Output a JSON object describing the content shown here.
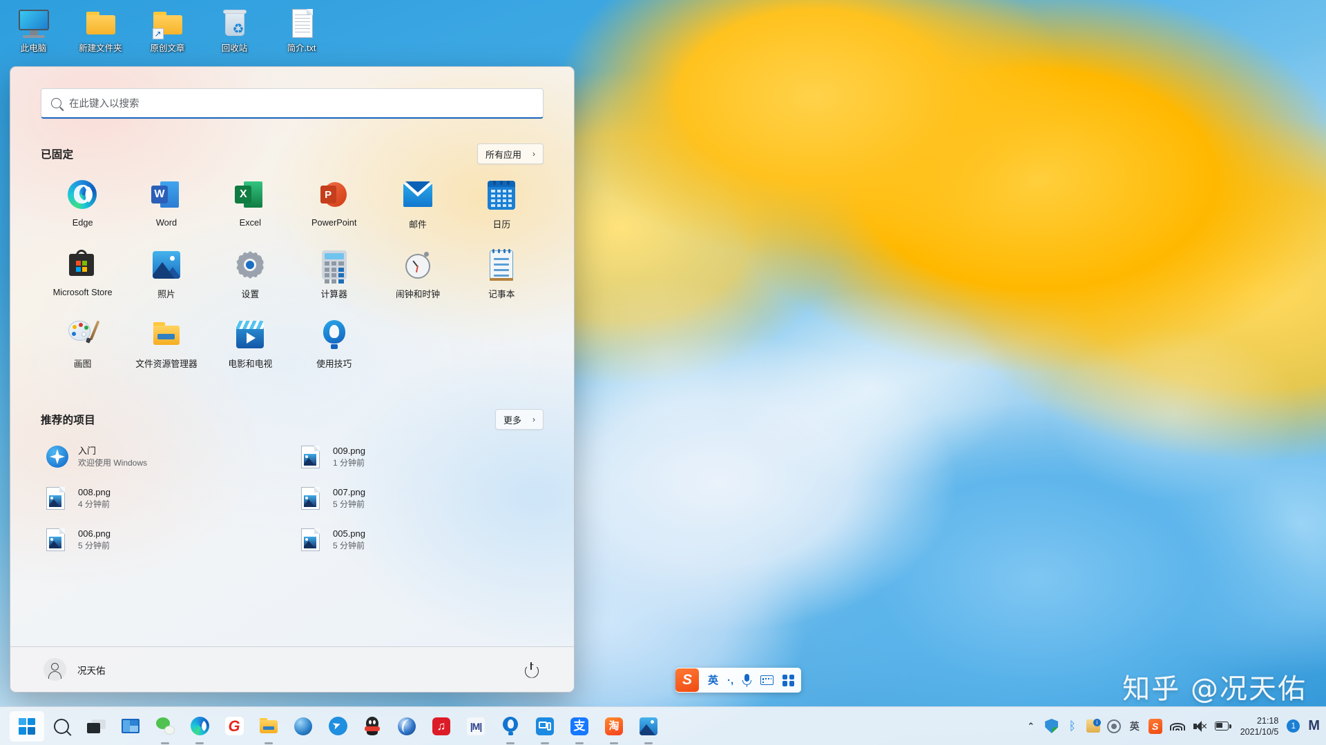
{
  "desktop": {
    "icons": [
      {
        "label": "此电脑",
        "icon": "this-pc-icon"
      },
      {
        "label": "新建文件夹",
        "icon": "folder-icon"
      },
      {
        "label": "原创文章",
        "icon": "folder-shortcut-icon"
      },
      {
        "label": "回收站",
        "icon": "recycle-bin-icon"
      },
      {
        "label": "简介.txt",
        "icon": "text-file-icon"
      }
    ],
    "watermark": "知乎 @况天佑"
  },
  "start_menu": {
    "search": {
      "placeholder": "在此键入以搜索",
      "value": "",
      "icon": "search-icon"
    },
    "pinned": {
      "title": "已固定",
      "all_apps_label": "所有应用",
      "chevron": "›",
      "apps": [
        {
          "name": "Edge",
          "icon": "edge-icon"
        },
        {
          "name": "Word",
          "icon": "word-icon"
        },
        {
          "name": "Excel",
          "icon": "excel-icon"
        },
        {
          "name": "PowerPoint",
          "icon": "powerpoint-icon"
        },
        {
          "name": "邮件",
          "icon": "mail-icon"
        },
        {
          "name": "日历",
          "icon": "calendar-icon"
        },
        {
          "name": "Microsoft Store",
          "icon": "microsoft-store-icon"
        },
        {
          "name": "照片",
          "icon": "photos-icon"
        },
        {
          "name": "设置",
          "icon": "settings-gear-icon"
        },
        {
          "name": "计算器",
          "icon": "calculator-icon"
        },
        {
          "name": "闹钟和时钟",
          "icon": "alarm-clock-icon"
        },
        {
          "name": "记事本",
          "icon": "notepad-icon"
        },
        {
          "name": "画图",
          "icon": "paint-icon"
        },
        {
          "name": "文件资源管理器",
          "icon": "file-explorer-icon"
        },
        {
          "name": "电影和电视",
          "icon": "movies-tv-icon"
        },
        {
          "name": "使用技巧",
          "icon": "tips-bulb-icon"
        }
      ]
    },
    "recommended": {
      "title": "推荐的项目",
      "more_label": "更多",
      "chevron": "›",
      "items": [
        {
          "title": "入门",
          "subtitle": "欢迎使用 Windows",
          "icon": "get-started-icon"
        },
        {
          "title": "009.png",
          "subtitle": "1 分钟前",
          "icon": "image-file-icon"
        },
        {
          "title": "008.png",
          "subtitle": "4 分钟前",
          "icon": "image-file-icon"
        },
        {
          "title": "007.png",
          "subtitle": "5 分钟前",
          "icon": "image-file-icon"
        },
        {
          "title": "006.png",
          "subtitle": "5 分钟前",
          "icon": "image-file-icon"
        },
        {
          "title": "005.png",
          "subtitle": "5 分钟前",
          "icon": "image-file-icon"
        }
      ]
    },
    "footer": {
      "user_name": "况天佑",
      "avatar_icon": "user-avatar-icon",
      "power_icon": "power-icon"
    }
  },
  "ime_bar": {
    "logo": "S",
    "mode": "英",
    "punctuation": "·,",
    "mic_icon": "microphone-icon",
    "keyboard_icon": "keyboard-icon",
    "apps_icon": "ime-apps-grid-icon"
  },
  "taskbar": {
    "left_items": [
      {
        "name": "start-button",
        "icon": "windows-logo-icon",
        "active": true,
        "running": false
      },
      {
        "name": "search-button",
        "icon": "search-icon",
        "active": false,
        "running": false
      },
      {
        "name": "task-view-button",
        "icon": "task-view-icon",
        "active": false,
        "running": false
      },
      {
        "name": "widgets-button",
        "icon": "widgets-icon",
        "active": false,
        "running": false
      },
      {
        "name": "wechat",
        "icon": "wechat-icon",
        "active": false,
        "running": true
      },
      {
        "name": "edge",
        "icon": "edge-icon",
        "active": false,
        "running": true
      },
      {
        "name": "g-browser",
        "icon": "g-browser-icon",
        "active": false,
        "running": false
      },
      {
        "name": "file-explorer",
        "icon": "file-explorer-icon",
        "active": false,
        "running": true
      },
      {
        "name": "blue-sphere-app",
        "icon": "blue-sphere-icon",
        "active": false,
        "running": false
      },
      {
        "name": "paper-plane-app",
        "icon": "paper-plane-icon",
        "active": false,
        "running": false
      },
      {
        "name": "qq",
        "icon": "qq-penguin-icon",
        "active": false,
        "running": false
      },
      {
        "name": "blue-orb-app",
        "icon": "blue-orb-icon",
        "active": false,
        "running": false
      },
      {
        "name": "netease-music",
        "icon": "netease-music-icon",
        "active": false,
        "running": false
      },
      {
        "name": "mindmaster",
        "icon": "mindmaster-icon",
        "active": false,
        "running": false
      },
      {
        "name": "tips",
        "icon": "tips-bulb-icon",
        "active": false,
        "running": true
      },
      {
        "name": "remote-desktop",
        "icon": "remote-desktop-icon",
        "active": false,
        "running": true
      },
      {
        "name": "alipay",
        "icon": "alipay-icon",
        "active": false,
        "running": true
      },
      {
        "name": "taobao",
        "icon": "taobao-icon",
        "active": false,
        "running": true
      },
      {
        "name": "photos",
        "icon": "photos-icon",
        "active": false,
        "running": true
      }
    ],
    "tray": {
      "overflow_chevron": "⌃",
      "items": [
        {
          "name": "windows-defender",
          "icon": "shield-icon"
        },
        {
          "name": "bluetooth",
          "icon": "bluetooth-icon"
        },
        {
          "name": "update-notice",
          "icon": "update-folder-icon"
        },
        {
          "name": "360-safe",
          "icon": "360-ring-icon"
        },
        {
          "name": "ime-indicator",
          "icon": "ime-text-icon",
          "label": "英"
        },
        {
          "name": "sogou-ime",
          "icon": "sogou-s-icon",
          "label": "S"
        },
        {
          "name": "network",
          "icon": "wifi-icon"
        },
        {
          "name": "volume",
          "icon": "speaker-muted-icon"
        },
        {
          "name": "battery",
          "icon": "battery-charging-icon"
        }
      ],
      "clock": {
        "time": "21:18",
        "date": "2021/10/5"
      },
      "notification_count": "1",
      "corner_mark": "M"
    }
  },
  "colors": {
    "accent": "#1565c0",
    "taskbar_bg": "#eef3f8",
    "start_menu_text": "#1b1c1e"
  }
}
